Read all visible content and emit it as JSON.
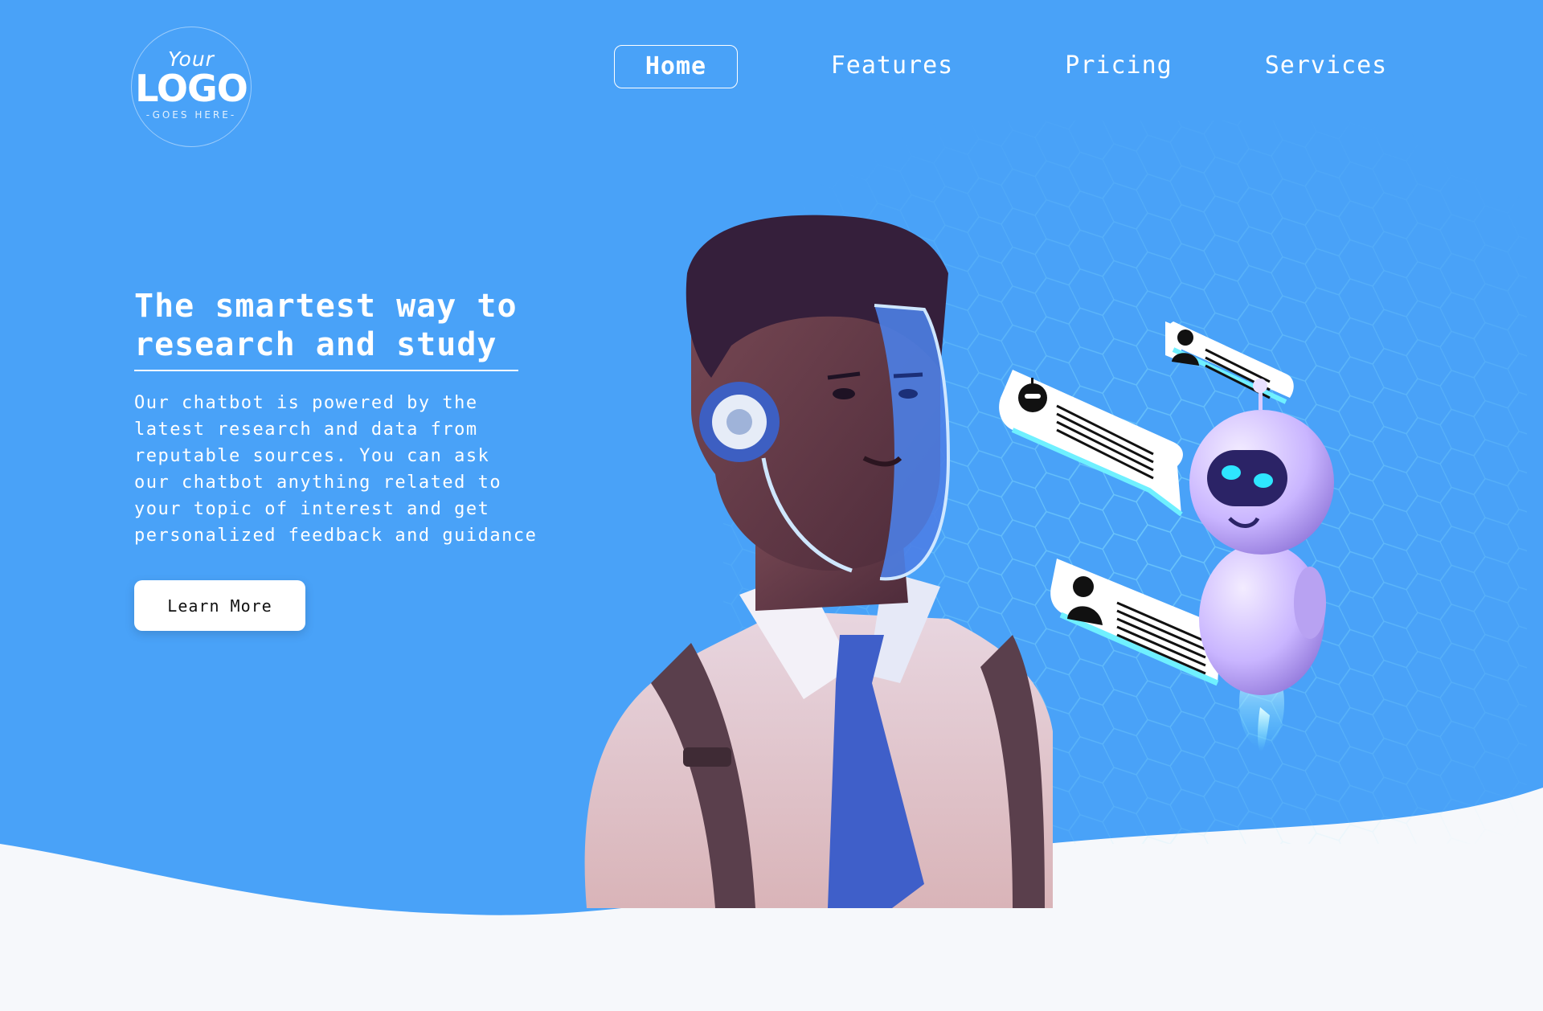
{
  "brand": {
    "logo_top": "Your",
    "logo_main": "LOGO",
    "logo_sub": "-GOES HERE-"
  },
  "nav": {
    "items": [
      {
        "label": "Home",
        "active": true
      },
      {
        "label": "Features",
        "active": false
      },
      {
        "label": "Pricing",
        "active": false
      },
      {
        "label": "Services",
        "active": false
      }
    ]
  },
  "hero": {
    "headline_line1": "The smartest way to",
    "headline_line2": "research and study",
    "description_lines": [
      "Our chatbot is powered by the",
      "latest research and data from",
      "reputable sources. You can ask",
      "our chatbot anything related to",
      "your topic of interest and get",
      "personalized feedback and guidance"
    ],
    "cta_label": "Learn More"
  },
  "colors": {
    "hero_blue": "#49a2f8",
    "page_bg": "#f6f8fb",
    "accent_cyan": "#6ff0ff",
    "robot_purple": "#c9b5ff"
  },
  "icons": [
    "robot-icon",
    "user-icon"
  ]
}
